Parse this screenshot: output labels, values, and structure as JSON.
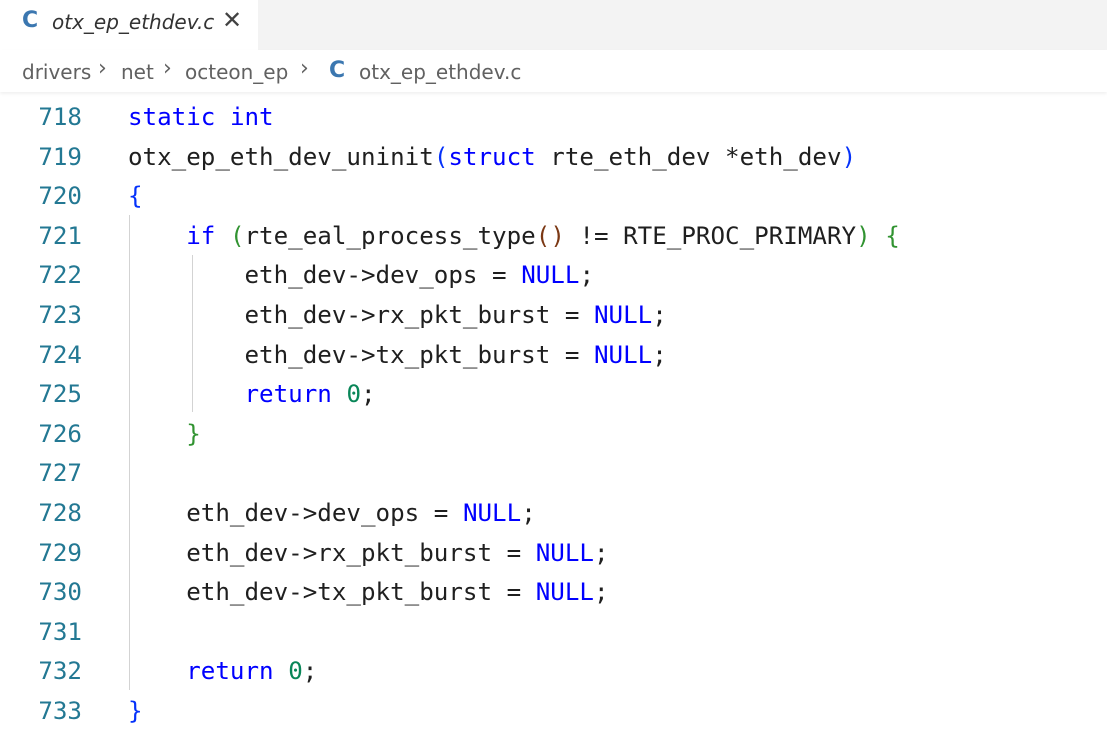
{
  "tab": {
    "icon": "C",
    "filename": "otx_ep_ethdev.c",
    "close": "✕"
  },
  "breadcrumb": {
    "items": [
      "drivers",
      "net",
      "octeon_ep"
    ],
    "separator": "›",
    "file_icon": "C",
    "file": "otx_ep_ethdev.c"
  },
  "colors": {
    "keyword": "#0000ff",
    "number": "#098658",
    "line_number": "#237893",
    "bracket_1": "#0431fa",
    "bracket_2": "#319331",
    "bracket_3": "#7b3814",
    "file_icon": "#3b77b0"
  },
  "lines": [
    {
      "n": "718",
      "text": "static int"
    },
    {
      "n": "719",
      "text": "otx_ep_eth_dev_uninit(struct rte_eth_dev *eth_dev)"
    },
    {
      "n": "720",
      "text": "{"
    },
    {
      "n": "721",
      "text": "    if (rte_eal_process_type() != RTE_PROC_PRIMARY) {"
    },
    {
      "n": "722",
      "text": "        eth_dev->dev_ops = NULL;"
    },
    {
      "n": "723",
      "text": "        eth_dev->rx_pkt_burst = NULL;"
    },
    {
      "n": "724",
      "text": "        eth_dev->tx_pkt_burst = NULL;"
    },
    {
      "n": "725",
      "text": "        return 0;"
    },
    {
      "n": "726",
      "text": "    }"
    },
    {
      "n": "727",
      "text": ""
    },
    {
      "n": "728",
      "text": "    eth_dev->dev_ops = NULL;"
    },
    {
      "n": "729",
      "text": "    eth_dev->rx_pkt_burst = NULL;"
    },
    {
      "n": "730",
      "text": "    eth_dev->tx_pkt_burst = NULL;"
    },
    {
      "n": "731",
      "text": ""
    },
    {
      "n": "732",
      "text": "    return 0;"
    },
    {
      "n": "733",
      "text": "}"
    }
  ]
}
